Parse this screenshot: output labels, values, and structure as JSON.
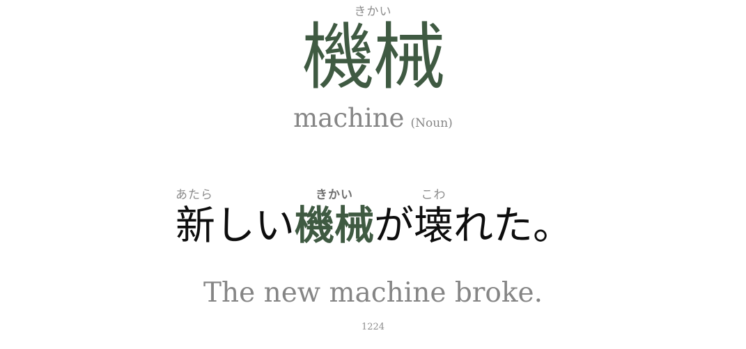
{
  "word": {
    "reading": "きかい",
    "kanji": "機械",
    "meaning": "machine",
    "part_of_speech": "(Noun)"
  },
  "sentence": {
    "segments": [
      {
        "ruby": "あたら",
        "text": "新しい",
        "highlight": false
      },
      {
        "ruby": "きかい",
        "text": "機械",
        "highlight": true
      },
      {
        "ruby": "",
        "text": "が",
        "highlight": false
      },
      {
        "ruby": "こわ",
        "text": "壊れた。",
        "highlight": false
      }
    ]
  },
  "translation": "The new machine broke.",
  "card_id": "1224",
  "colors": {
    "accent": "#3f5a42",
    "muted": "#858585",
    "text": "#0d0d0d"
  }
}
